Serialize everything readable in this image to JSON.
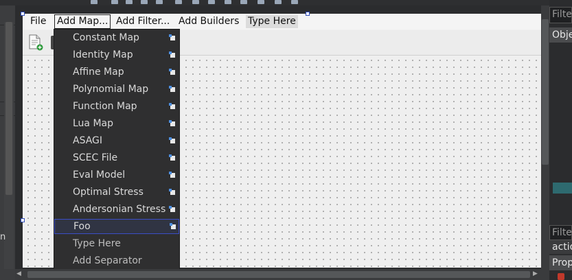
{
  "window": {
    "left_panel_fragment": "n"
  },
  "menubar": {
    "file": "File",
    "add_map": "Add Map...",
    "add_filter": "Add Filter...",
    "add_builders": "Add Builders",
    "type_here": "Type Here"
  },
  "add_map_menu": {
    "items": [
      {
        "label": "Constant Map",
        "icon": "submenu-icon"
      },
      {
        "label": "Identity Map",
        "icon": "submenu-icon"
      },
      {
        "label": "Affine Map",
        "icon": "submenu-icon"
      },
      {
        "label": "Polynomial Map",
        "icon": "submenu-icon"
      },
      {
        "label": "Function Map",
        "icon": "submenu-icon"
      },
      {
        "label": "Lua Map",
        "icon": "submenu-icon"
      },
      {
        "label": "ASAGI",
        "icon": "submenu-icon"
      },
      {
        "label": "SCEC File",
        "icon": "submenu-icon"
      },
      {
        "label": "Eval Model",
        "icon": "submenu-icon"
      },
      {
        "label": "Optimal Stress",
        "icon": "submenu-icon"
      },
      {
        "label": "Andersonian Stress",
        "icon": "submenu-icon"
      },
      {
        "label": "Foo",
        "icon": "submenu-icon",
        "selected": true
      },
      {
        "label": "Type Here"
      },
      {
        "label": "Add Separator"
      }
    ]
  },
  "right_panel": {
    "filter_top": "Filte",
    "object_header": "Obje",
    "filter_bottom": "Filte",
    "action_row": "actio",
    "properties_row": "Prop"
  },
  "colors": {
    "menu_bg": "#2f2f30",
    "menu_text": "#d9d9d9",
    "selection_border": "#3b4ec6",
    "form_bg": "#efefef",
    "teal_row": "#2e6a6f"
  }
}
